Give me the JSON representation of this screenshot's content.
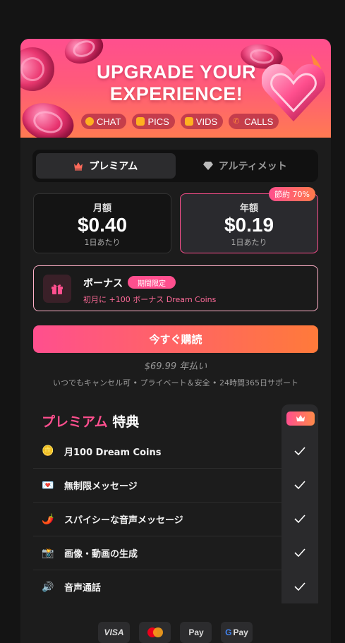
{
  "banner": {
    "title_line1": "UPGRADE YOUR",
    "title_line2": "EXPERIENCE!",
    "chips": [
      {
        "label": "CHAT",
        "icon": "chat-bubble-icon",
        "color": "#ffb020"
      },
      {
        "label": "PICS",
        "icon": "picture-icon",
        "color": "#ffb020"
      },
      {
        "label": "VIDS",
        "icon": "video-icon",
        "color": "#ffb020"
      },
      {
        "label": "CALLS",
        "icon": "phone-icon",
        "color": "#ff8a3a"
      }
    ]
  },
  "tabs": [
    {
      "label": "プレミアム",
      "icon": "crown-icon",
      "active": true
    },
    {
      "label": "アルティメット",
      "icon": "diamond-icon",
      "active": false
    }
  ],
  "plans": {
    "monthly": {
      "label": "月額",
      "price": "$0.40",
      "per": "1日あたり"
    },
    "yearly": {
      "label": "年額",
      "price": "$0.19",
      "per": "1日あたり",
      "badge": "節約 70%",
      "selected": true
    }
  },
  "bonus": {
    "title": "ボーナス",
    "badge": "期間限定",
    "subtitle": "初月に +100 ボーナス Dream Coins"
  },
  "cta": {
    "label": "今すぐ購読"
  },
  "total": "$69.99 年払い",
  "notes": "いつでもキャンセル可 • プライベート＆安全 • 24時間365日サポート",
  "features": {
    "title_accent": "プレミアム",
    "title_rest": " 特典",
    "items": [
      {
        "label": "月100 Dream Coins",
        "icon": "coin-icon",
        "emoji": "🪙"
      },
      {
        "label": "無制限メッセージ",
        "icon": "love-letter-icon",
        "emoji": "💌"
      },
      {
        "label": "スパイシーな音声メッセージ",
        "icon": "chili-pepper-icon",
        "emoji": "🌶️"
      },
      {
        "label": "画像・動画の生成",
        "icon": "camera-icon",
        "emoji": "📸"
      },
      {
        "label": "音声通話",
        "icon": "speaker-icon",
        "emoji": "🔊"
      }
    ]
  },
  "payments": [
    {
      "label": "VISA",
      "icon": "visa-icon"
    },
    {
      "label": "",
      "icon": "mastercard-icon"
    },
    {
      "label": "Pay",
      "icon": "apple-pay-icon"
    },
    {
      "label": "Pay",
      "icon": "google-pay-icon"
    }
  ],
  "colors": {
    "accent": "#ff4f8e",
    "accent2": "#ff7a3a",
    "bg": "#141414",
    "card": "#1c1c1c"
  }
}
